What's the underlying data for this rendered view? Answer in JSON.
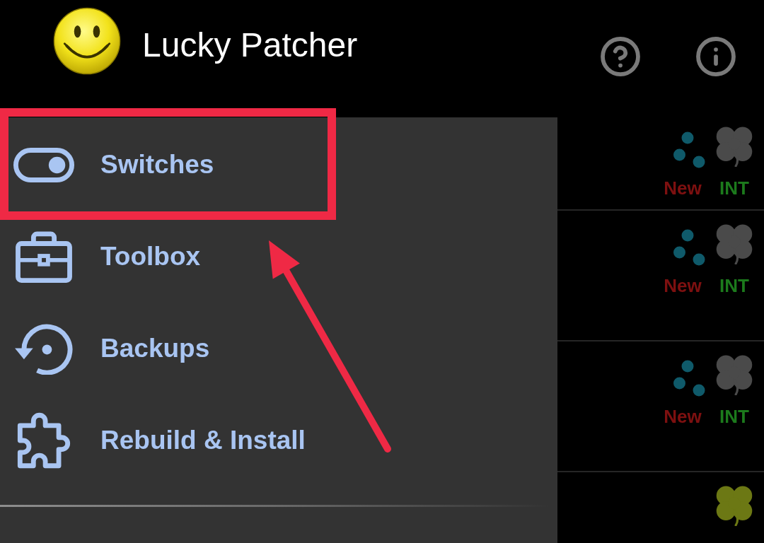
{
  "app_bar": {
    "title": "Lucky Patcher"
  },
  "drawer": {
    "items": [
      {
        "label": "Switches",
        "highlighted": true
      },
      {
        "label": "Toolbox",
        "highlighted": false
      },
      {
        "label": "Backups",
        "highlighted": false
      },
      {
        "label": "Rebuild & Install",
        "highlighted": false
      }
    ]
  },
  "app_list": {
    "rows": [
      {
        "has_dots": true,
        "color": "#4a4a4a",
        "tags": [
          {
            "label": "New",
            "color": "#7d1010"
          },
          {
            "label": "INT",
            "color": "#1c7a1c"
          }
        ]
      },
      {
        "has_dots": true,
        "color": "#4a4a4a",
        "tags": [
          {
            "label": "New",
            "color": "#7d1010"
          },
          {
            "label": "INT",
            "color": "#1c7a1c"
          }
        ]
      },
      {
        "has_dots": true,
        "color": "#4a4a4a",
        "tags": [
          {
            "label": "New",
            "color": "#7d1010"
          },
          {
            "label": "INT",
            "color": "#1c7a1c"
          }
        ]
      },
      {
        "has_dots": false,
        "color": "#6c7814"
      }
    ]
  }
}
